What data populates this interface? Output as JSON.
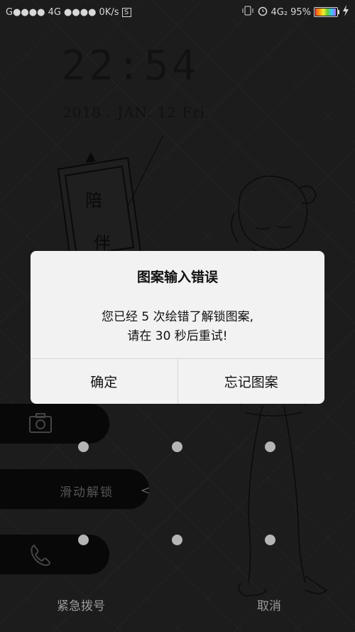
{
  "status_bar": {
    "left_text": "G●●●● 4G ●●●● 0K/s",
    "s_badge": "S",
    "network": "4G₂",
    "battery": "95%",
    "battery_level": 0.95
  },
  "lockscreen": {
    "time": "22:54",
    "date": "2018 . JAN. 12  Fri.",
    "slide_label": "滑动解锁",
    "slide_arrow": "<",
    "emergency_label": "紧急拨号",
    "cancel_label": "取消"
  },
  "dialog": {
    "title": "图案输入错误",
    "message_line1": "您已经 5 次绘错了解锁图案,",
    "message_line2": "请在 30 秒后重试!",
    "confirm_label": "确定",
    "forgot_label": "忘记图案"
  },
  "colors": {
    "dialog_bg": "#f2f2f2",
    "pill_bg": "#080808",
    "pattern_dot": "#b5b5b5"
  }
}
